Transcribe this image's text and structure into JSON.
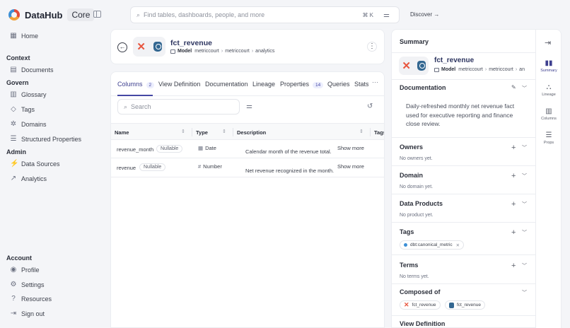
{
  "brand": {
    "name": "DataHub",
    "tag": "Core"
  },
  "sidebar": {
    "home": "Home",
    "context_head": "Context",
    "documents": "Documents",
    "govern_head": "Govern",
    "glossary": "Glossary",
    "tags": "Tags",
    "domains": "Domains",
    "structured": "Structured Properties",
    "admin_head": "Admin",
    "data_sources": "Data Sources",
    "analytics": "Analytics",
    "account_head": "Account",
    "profile": "Profile",
    "settings": "Settings",
    "resources": "Resources",
    "sign_out": "Sign out"
  },
  "search": {
    "placeholder": "Find tables, dashboards, people, and more",
    "shortcut": "⌘ K"
  },
  "discover": "Discover",
  "entity": {
    "title": "fct_revenue",
    "type": "Model",
    "crumbs": [
      "metriccourt",
      "metriccourt",
      "analytics"
    ]
  },
  "tabs": [
    {
      "label": "Columns",
      "count": "2"
    },
    {
      "label": "View Definition"
    },
    {
      "label": "Documentation"
    },
    {
      "label": "Lineage"
    },
    {
      "label": "Properties",
      "count": "14"
    },
    {
      "label": "Queries"
    },
    {
      "label": "Stats"
    }
  ],
  "tabs_more": "···",
  "col_search_placeholder": "Search",
  "table": {
    "headers": [
      "Name",
      "Type",
      "Description",
      "Tags"
    ],
    "rows": [
      {
        "name": "revenue_month",
        "nullable": "Nullable",
        "type": "Date",
        "desc": "Calendar month of the revenue total.",
        "more": "Show more"
      },
      {
        "name": "revenue",
        "nullable": "Nullable",
        "type": "Number",
        "desc": "Net revenue recognized in the month.",
        "more": "Show more"
      }
    ]
  },
  "summary": {
    "title": "Summary",
    "entity_title": "fct_revenue",
    "entity_type": "Model",
    "crumbs": [
      "metriccourt",
      "metriccourt",
      "an"
    ],
    "documentation_label": "Documentation",
    "documentation_text": "Daily-refreshed monthly net revenue fact used for executive reporting and finance close review.",
    "owners_label": "Owners",
    "owners_empty": "No owners yet.",
    "domain_label": "Domain",
    "domain_empty": "No domain yet.",
    "products_label": "Data Products",
    "products_empty": "No product yet.",
    "tags_label": "Tags",
    "tag_value": "dbt:canonical_metric",
    "terms_label": "Terms",
    "terms_empty": "No terms yet.",
    "composed_label": "Composed of",
    "composed": [
      "fct_revenue",
      "fct_revenue"
    ],
    "cut_label": "View Definition"
  },
  "rail": [
    "Summary",
    "Lineage",
    "Columns",
    "Props"
  ],
  "colors": {
    "accent": "#4547a4",
    "title": "#2d3560",
    "tag_dot": "#3c8fd6"
  }
}
